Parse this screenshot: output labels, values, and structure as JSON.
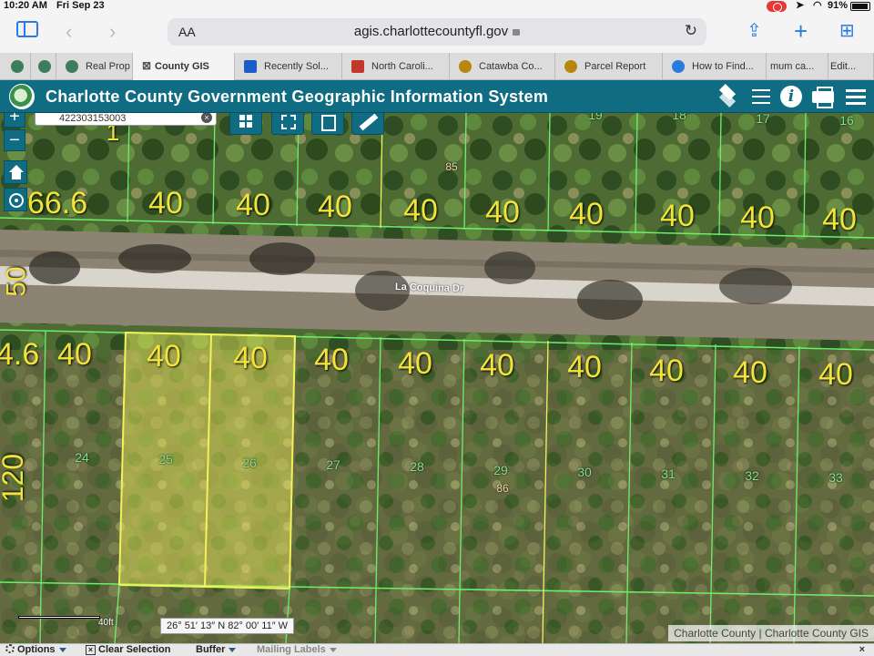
{
  "status_bar": {
    "time": "10:20 AM",
    "date": "Fri Sep 23",
    "battery": "91%"
  },
  "browser": {
    "text_size_label": "AA",
    "url": "agis.charlottecountyfl.gov"
  },
  "tabs": [
    {
      "label": "",
      "fav_color": "#3e7d5a"
    },
    {
      "label": "Real Prop",
      "fav_color": "#3e7d5a"
    },
    {
      "label": "County GIS",
      "active": true
    },
    {
      "label": "Recently Sol...",
      "fav_color": "#1a5cc8"
    },
    {
      "label": "North Caroli...",
      "fav_color": "#c0392b"
    },
    {
      "label": "Catawba Co...",
      "fav_color": "#b8860b"
    },
    {
      "label": "Parcel Report",
      "fav_color": "#b8860b"
    },
    {
      "label": "How to Find...",
      "fav_color": "#2a7ae2"
    },
    {
      "label": "mum ca..."
    },
    {
      "label": "Edit..."
    }
  ],
  "gis": {
    "title": "Charlotte County Government Geographic Information System"
  },
  "search": {
    "value": "422303153003",
    "clear": "×"
  },
  "map_controls": {
    "zoom_in": "+",
    "zoom_out": "−"
  },
  "map": {
    "street_name": "La Coquina Dr",
    "top_lot_numbers": [
      "16",
      "17",
      "18",
      "19"
    ],
    "top_partial_label": "1",
    "top_widths": [
      "40",
      "40",
      "40",
      "40",
      "40",
      "40",
      "40",
      "40",
      "40"
    ],
    "top_left_width": "66.6",
    "road_width": "50",
    "bottom_left_width": "4.6",
    "bottom_widths": [
      "40",
      "40",
      "40",
      "40",
      "40",
      "40",
      "40",
      "40",
      "40",
      "40"
    ],
    "side_depth": "120",
    "bottom_lot_numbers": [
      "24",
      "25",
      "26",
      "27",
      "28",
      "29",
      "30",
      "31",
      "32",
      "33"
    ],
    "block_numbers": [
      "85",
      "86"
    ],
    "selected_lots": [
      "25",
      "26"
    ]
  },
  "scale": {
    "label": "40ft"
  },
  "coordinates": "26° 51′ 13″ N 82° 00′ 11″ W",
  "attribution": "Charlotte County | Charlotte County GIS",
  "bottom_bar": {
    "options": "Options",
    "clear_selection": "Clear Selection",
    "buffer": "Buffer",
    "mailing_labels": "Mailing Labels",
    "close": "×"
  },
  "colors": {
    "header": "#0f6c82",
    "lot_labels": "#f1e33a",
    "parcel_lines": "#6cf06c",
    "selection": "#f4f25a"
  }
}
